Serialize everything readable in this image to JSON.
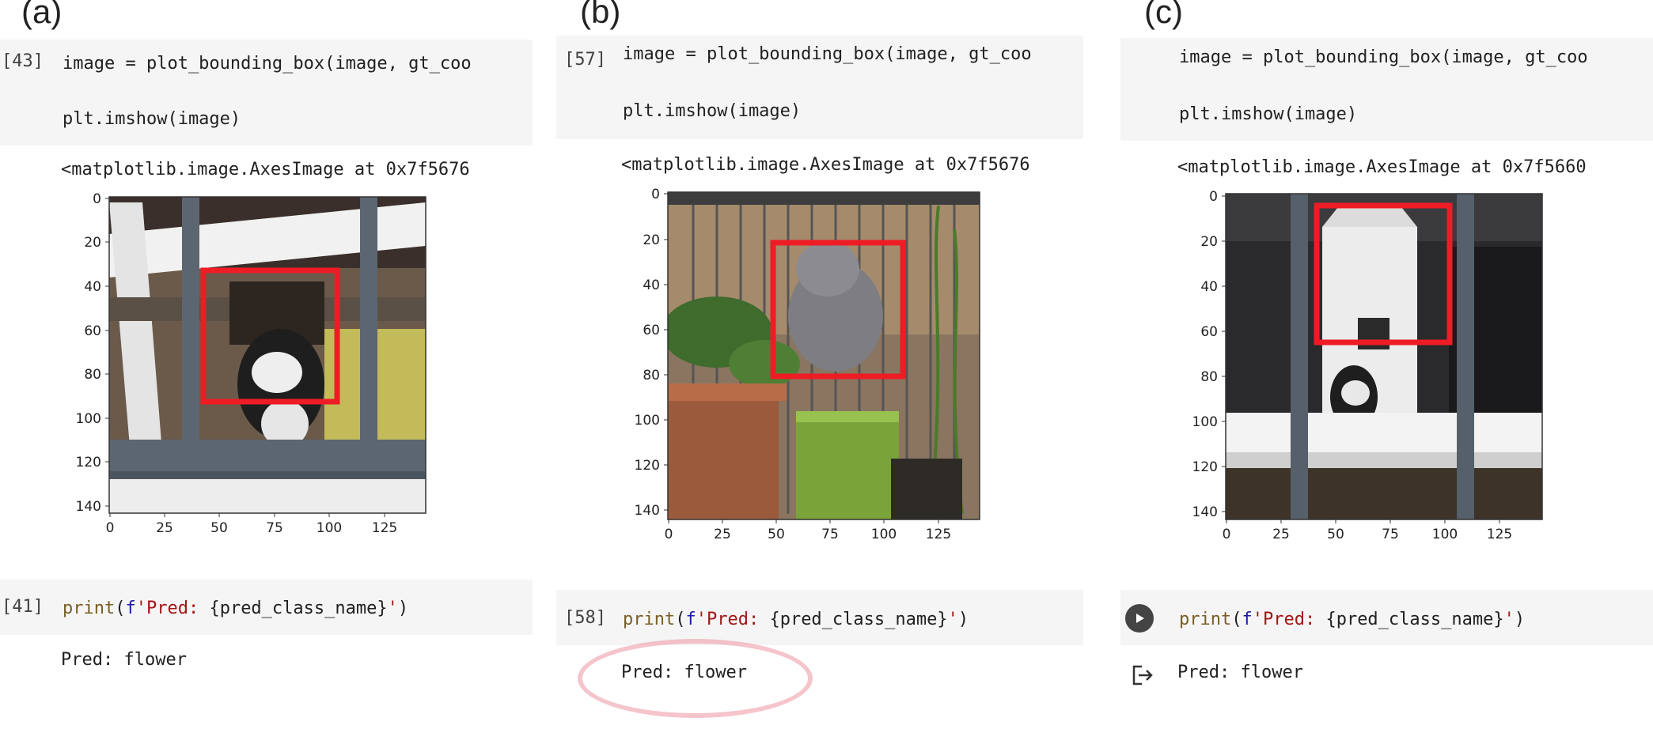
{
  "panels": [
    {
      "label": "(a)",
      "cell1": {
        "exec_count": "[43]",
        "line1": "image = plot_bounding_box(image, gt_coo",
        "line2": "plt.imshow(image)"
      },
      "output_repr": "<matplotlib.image.AxesImage at 0x7f5676",
      "cell2": {
        "exec_count": "[41]",
        "print_kw": "print",
        "paren_open": "(",
        "f_prefix": "f",
        "str_part": "'Pred: ",
        "brace_part": "{pred_class_name}",
        "str_end": "'",
        "paren_close": ")"
      },
      "output_text": "Pred: flower",
      "plot": {
        "y_ticks": [
          "0",
          "20",
          "40",
          "60",
          "80",
          "100",
          "120",
          "140"
        ],
        "x_ticks": [
          "0",
          "25",
          "50",
          "75",
          "100",
          "125"
        ],
        "image_content": "cat-behind-railing",
        "bbox_data": {
          "x_min": 43,
          "y_min": 33,
          "x_max": 104,
          "y_max": 93
        }
      }
    },
    {
      "label": "(b)",
      "cell1": {
        "exec_count": "[57]",
        "line1": "image = plot_bounding_box(image, gt_coo",
        "line2": "plt.imshow(image)"
      },
      "output_repr": "<matplotlib.image.AxesImage at 0x7f5676",
      "cell2": {
        "exec_count": "[58]",
        "print_kw": "print",
        "paren_open": "(",
        "f_prefix": "f",
        "str_part": "'Pred: ",
        "brace_part": "{pred_class_name}",
        "str_end": "'",
        "paren_close": ")"
      },
      "output_text": "Pred: flower",
      "highlighted": true,
      "plot": {
        "y_ticks": [
          "0",
          "20",
          "40",
          "60",
          "80",
          "100",
          "120",
          "140"
        ],
        "x_ticks": [
          "0",
          "25",
          "50",
          "75",
          "100",
          "125"
        ],
        "image_content": "cat-behind-plants",
        "bbox_data": {
          "x_min": 47,
          "y_min": 23,
          "x_max": 108,
          "y_max": 84
        }
      }
    },
    {
      "label": "(c)",
      "cell1": {
        "exec_count": "",
        "line1": "image = plot_bounding_box(image, gt_coo",
        "line2": "plt.imshow(image)"
      },
      "output_repr": "<matplotlib.image.AxesImage at 0x7f5660",
      "cell2": {
        "exec_count": "",
        "run_icon": "play-circle-icon",
        "print_kw": "print",
        "paren_open": "(",
        "f_prefix": "f",
        "str_part": "'Pred: ",
        "brace_part": "{pred_class_name}",
        "str_end": "'",
        "paren_close": ")"
      },
      "output_icon": "output-arrow-icon",
      "output_text": "Pred: flower",
      "plot": {
        "y_ticks": [
          "0",
          "20",
          "40",
          "60",
          "80",
          "100",
          "120",
          "140"
        ],
        "x_ticks": [
          "0",
          "25",
          "50",
          "75",
          "100",
          "125"
        ],
        "image_content": "cat-hidden-behind-box",
        "bbox_data": {
          "x_min": 40,
          "y_min": 5,
          "x_max": 101,
          "y_max": 67
        }
      }
    }
  ],
  "colors": {
    "bbox": "#ee1c25",
    "cell_bg": "#f5f5f5",
    "highlight": "#ec96a0"
  }
}
